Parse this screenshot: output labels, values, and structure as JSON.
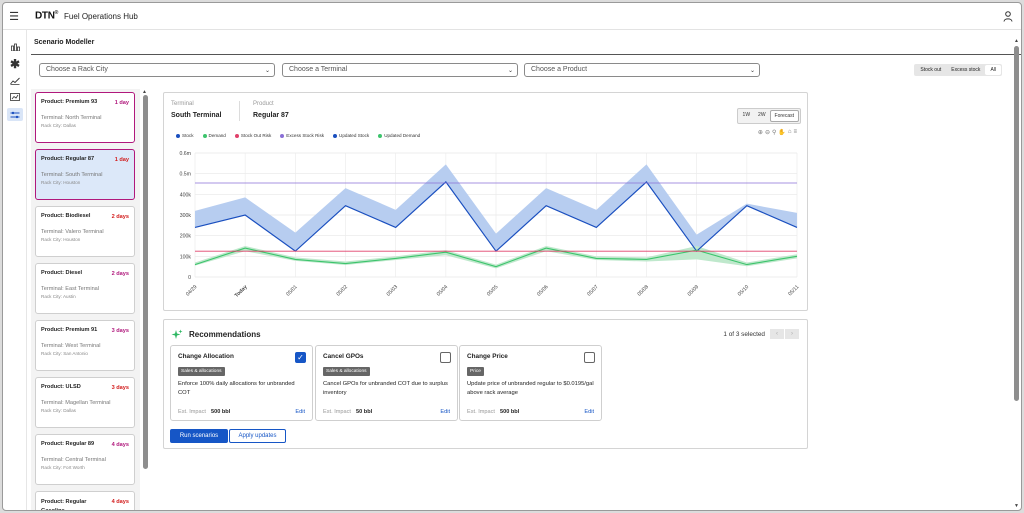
{
  "app": {
    "logo": "DTN",
    "title": "Fuel Operations Hub"
  },
  "page": {
    "title": "Scenario Modeller"
  },
  "filters": {
    "city": "Choose a Rack City",
    "terminal": "Choose a Terminal",
    "product": "Choose a Product"
  },
  "stock_filter": {
    "options": [
      "Stock out",
      "Excess stock",
      "All"
    ],
    "selected": "All"
  },
  "list": [
    {
      "product": "Product: Premium 93",
      "days": "1 day",
      "days_color": "#b0187c",
      "terminal": "Terminal: North Terminal",
      "city": "Rack City: Dallas"
    },
    {
      "product": "Product: Regular 87",
      "days": "1 day",
      "days_color": "#d21b1b",
      "terminal": "Terminal: South Terminal",
      "city": "Rack City: Houston"
    },
    {
      "product": "Product: Biodiesel",
      "days": "2 days",
      "days_color": "#d21b1b",
      "terminal": "Terminal: Valero Terminal",
      "city": "Rack City: Houston"
    },
    {
      "product": "Product: Diesel",
      "days": "2 days",
      "days_color": "#b0187c",
      "terminal": "Terminal: East Terminal",
      "city": "Rack City: Austin"
    },
    {
      "product": "Product: Premium 91",
      "days": "3 days",
      "days_color": "#b0187c",
      "terminal": "Terminal: West Terminal",
      "city": "Rack City: San Antonio"
    },
    {
      "product": "Product: ULSD",
      "days": "3 days",
      "days_color": "#d21b1b",
      "terminal": "Terminal: Magellan Terminal",
      "city": "Rack City: Dallas"
    },
    {
      "product": "Product: Regular 89",
      "days": "4 days",
      "days_color": "#b0187c",
      "terminal": "Terminal: Central Terminal",
      "city": "Rack City: Fort Worth"
    },
    {
      "product": "Product: Regular Gasoline",
      "days": "4 days",
      "days_color": "#d21b1b",
      "terminal": "",
      "city": ""
    }
  ],
  "chart_header": {
    "terminal_label": "Terminal",
    "terminal_value": "South Terminal",
    "product_label": "Product",
    "product_value": "Regular 87",
    "ranges": [
      "1W",
      "2W",
      "Forecast"
    ],
    "selected_range": "Forecast"
  },
  "chart_data": {
    "type": "line",
    "x": [
      "04/29",
      "Today",
      "05/01",
      "05/02",
      "05/03",
      "05/04",
      "05/05",
      "05/06",
      "05/07",
      "05/08",
      "05/09",
      "05/10",
      "05/11"
    ],
    "yticks": [
      "0",
      "100k",
      "200k",
      "300k",
      "400k",
      "0.5m",
      "0.6m"
    ],
    "ylim": [
      0,
      600000
    ],
    "series": [
      {
        "name": "Stock",
        "color": "#1a4fbf",
        "values": [
          240000,
          300000,
          125000,
          345000,
          240000,
          460000,
          125000,
          345000,
          240000,
          460000,
          125000,
          345000,
          240000
        ]
      },
      {
        "name": "Demand",
        "color": "#3cc46c",
        "values": [
          60000,
          140000,
          85000,
          65000,
          90000,
          120000,
          50000,
          140000,
          90000,
          85000,
          130000,
          60000,
          100000
        ]
      },
      {
        "name": "Stock Out Risk",
        "color": "#e0406a",
        "values": [
          125000,
          125000,
          125000,
          125000,
          125000,
          125000,
          125000,
          125000,
          125000,
          125000,
          125000,
          125000,
          125000
        ]
      },
      {
        "name": "Excess Stock Risk",
        "color": "#8a6fd6",
        "values": [
          455000,
          455000,
          455000,
          455000,
          455000,
          455000,
          455000,
          455000,
          455000,
          455000,
          455000,
          455000,
          455000
        ]
      },
      {
        "name": "Updated Stock",
        "color": "#1a4fbf",
        "values": [
          240000,
          300000,
          125000,
          345000,
          240000,
          460000,
          125000,
          345000,
          240000,
          460000,
          125000,
          345000,
          240000
        ]
      },
      {
        "name": "Updated Demand",
        "color": "#3cc46c",
        "values": [
          60000,
          140000,
          85000,
          65000,
          90000,
          120000,
          50000,
          140000,
          90000,
          85000,
          130000,
          60000,
          100000
        ]
      }
    ],
    "stock_band": {
      "lower": [
        240000,
        300000,
        125000,
        345000,
        240000,
        460000,
        125000,
        345000,
        240000,
        460000,
        125000,
        345000,
        240000
      ],
      "upper": [
        320000,
        385000,
        215000,
        430000,
        325000,
        545000,
        210000,
        430000,
        325000,
        545000,
        205000,
        355000,
        310000
      ]
    },
    "demand_band": {
      "lower": [
        55000,
        125000,
        78000,
        58000,
        82000,
        105000,
        42000,
        125000,
        82000,
        75000,
        85000,
        52000,
        90000
      ],
      "upper": [
        70000,
        150000,
        95000,
        75000,
        100000,
        130000,
        60000,
        150000,
        100000,
        95000,
        150000,
        70000,
        110000
      ]
    },
    "grid": true,
    "legend": "top-left"
  },
  "recommendations": {
    "title": "Recommendations",
    "count": "1 of 3 selected",
    "cards": [
      {
        "title": "Change Allocation",
        "checked": true,
        "tag": "Sales & allocations",
        "desc": "Enforce 100% daily allocations for unbranded COT",
        "impact_label": "Est. Impact",
        "impact": "500 bbl",
        "edit": "Edit"
      },
      {
        "title": "Cancel GPOs",
        "checked": false,
        "tag": "Sales & allocations",
        "desc": "Cancel GPOs for unbranded COT due to surplus inventory",
        "impact_label": "Est. Impact",
        "impact": "50 bbl",
        "edit": "Edit"
      },
      {
        "title": "Change Price",
        "checked": false,
        "tag": "Price",
        "desc": "Update price of unbranded regular to $0.0195/gal above rack average",
        "impact_label": "Est. Impact",
        "impact": "500 bbl",
        "edit": "Edit"
      }
    ],
    "run_label": "Run scenarios",
    "apply_label": "Apply updates"
  }
}
